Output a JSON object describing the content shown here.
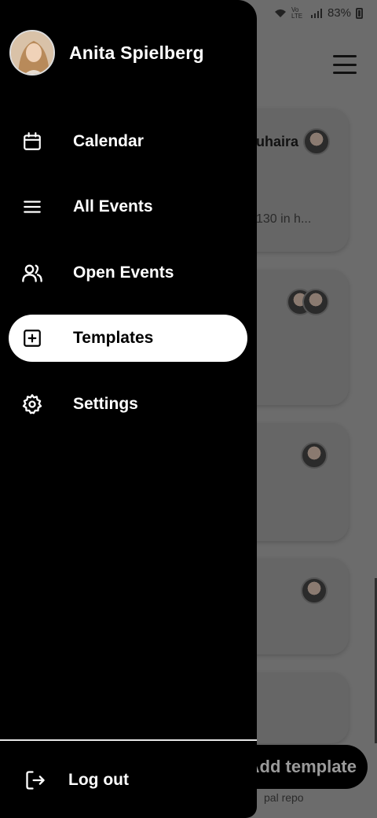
{
  "status_bar": {
    "network": "Vo LTE",
    "battery": "83%"
  },
  "user": {
    "name": "Anita Spielberg"
  },
  "nav": {
    "items": [
      {
        "label": "Calendar",
        "icon": "calendar-icon"
      },
      {
        "label": "All Events",
        "icon": "list-icon"
      },
      {
        "label": "Open Events",
        "icon": "users-icon"
      },
      {
        "label": "Templates",
        "icon": "plus-square-icon",
        "active": true
      },
      {
        "label": "Settings",
        "icon": "gear-icon"
      }
    ],
    "logout_label": "Log out"
  },
  "background": {
    "card1_name": "uhaira",
    "card1_sub": "130 in h...",
    "add_button": "Add template",
    "footer_text": "pal repo"
  },
  "colors": {
    "drawer_bg": "#000000",
    "active_item_bg": "#ffffff",
    "text": "#ffffff"
  }
}
